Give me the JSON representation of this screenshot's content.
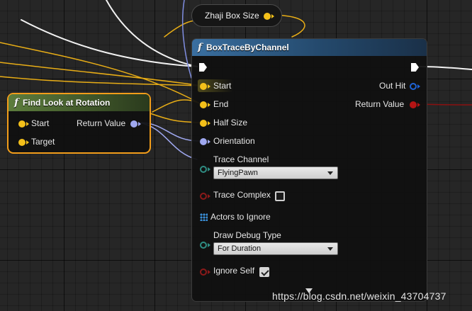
{
  "var_node": {
    "label": "Zhaji Box Size"
  },
  "find_look": {
    "title": "Find Look at Rotation",
    "icon": "function-icon",
    "inputs": [
      "Start",
      "Target"
    ],
    "output": "Return Value"
  },
  "box_trace": {
    "title": "BoxTraceByChannel",
    "icon": "function-icon",
    "inputs": {
      "start": "Start",
      "end": "End",
      "half_size": "Half Size",
      "orientation": "Orientation",
      "trace_channel": "Trace Channel",
      "trace_channel_value": "FlyingPawn",
      "trace_complex": "Trace Complex",
      "trace_complex_checked": false,
      "actors_to_ignore": "Actors to Ignore",
      "draw_debug_type": "Draw Debug Type",
      "draw_debug_type_value": "For Duration",
      "ignore_self": "Ignore Self",
      "ignore_self_checked": true
    },
    "outputs": {
      "out_hit": "Out Hit",
      "return_value": "Return Value"
    }
  },
  "colors": {
    "function_header": "#2a5276",
    "find_header": "#4f6b34",
    "selection_outline": "#f29d1a",
    "vector_pin": "#f4c01a",
    "rotator_pin": "#9fa8f0",
    "struct_pin": "#1f63d6",
    "bool_pin": "#b41414",
    "byte_pin": "#2f8d83"
  },
  "watermark": "https://blog.csdn.net/weixin_43704737"
}
